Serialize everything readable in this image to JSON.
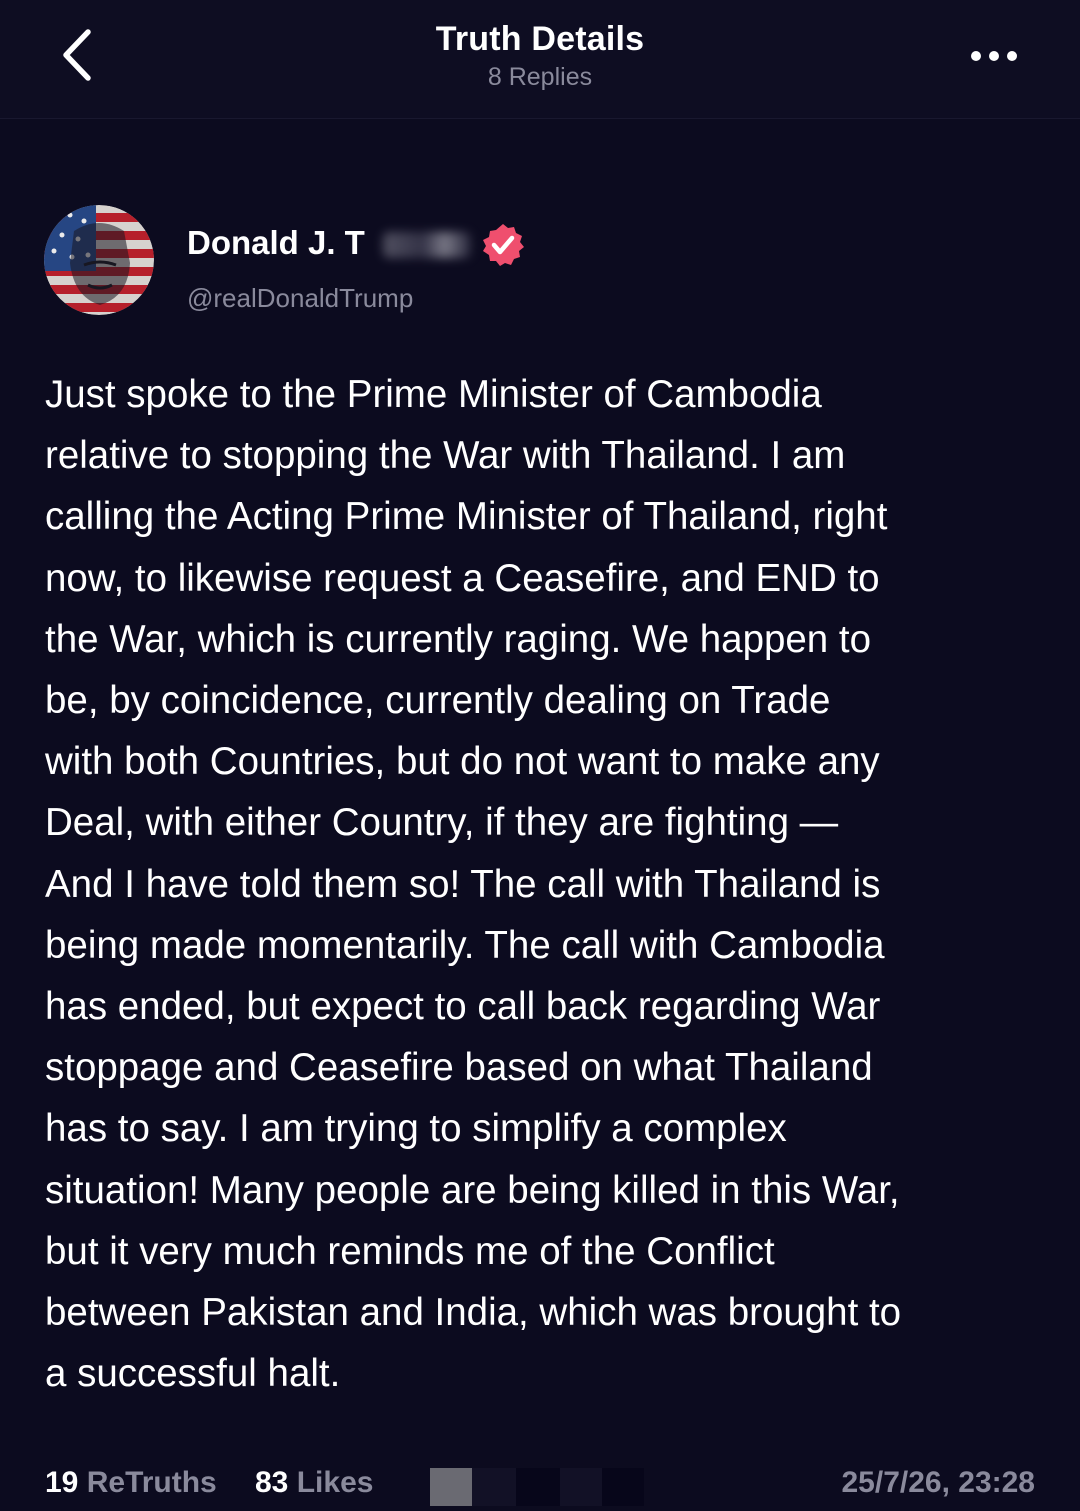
{
  "header": {
    "title": "Truth Details",
    "subtitle": "8 Replies",
    "back_icon": "chevron-left-icon",
    "more_icon": "ellipsis-icon"
  },
  "author": {
    "name": "Donald J. T",
    "handle": "@realDonaldTrump",
    "verified_icon": "verified-badge-icon",
    "verified_color": "#ef4f6e"
  },
  "post": {
    "lines": [
      "Just spoke to the Prime Minister of Cambodia",
      "relative to stopping the War with Thailand. I am",
      "calling the Acting Prime Minister of Thailand, right",
      "now, to likewise request a Ceasefire, and END to",
      "the War, which is currently raging. We happen to",
      "be, by coincidence, currently dealing on Trade",
      "with both Countries, but do not want to make any",
      "Deal, with either Country, if they are fighting —",
      "And I have told them so! The call with Thailand is",
      "being made momentarily. The call with Cambodia",
      "has ended, but expect to call back regarding War",
      "stoppage and Ceasefire based on what Thailand",
      "has to say. I am trying to simplify a complex",
      "situation! Many people are being killed in this War,",
      "but it very much reminds me of the Conflict",
      "between Pakistan and India, which was brought to",
      "a successful halt."
    ]
  },
  "stats": {
    "retruths_count": "19",
    "retruths_label": "ReTruths",
    "likes_count": "83",
    "likes_label": "Likes",
    "timestamp": "25/7/26, 23:28"
  },
  "colors": {
    "background": "#0c0b1f",
    "text_primary": "#ffffff",
    "text_secondary": "#8a8a9c"
  }
}
